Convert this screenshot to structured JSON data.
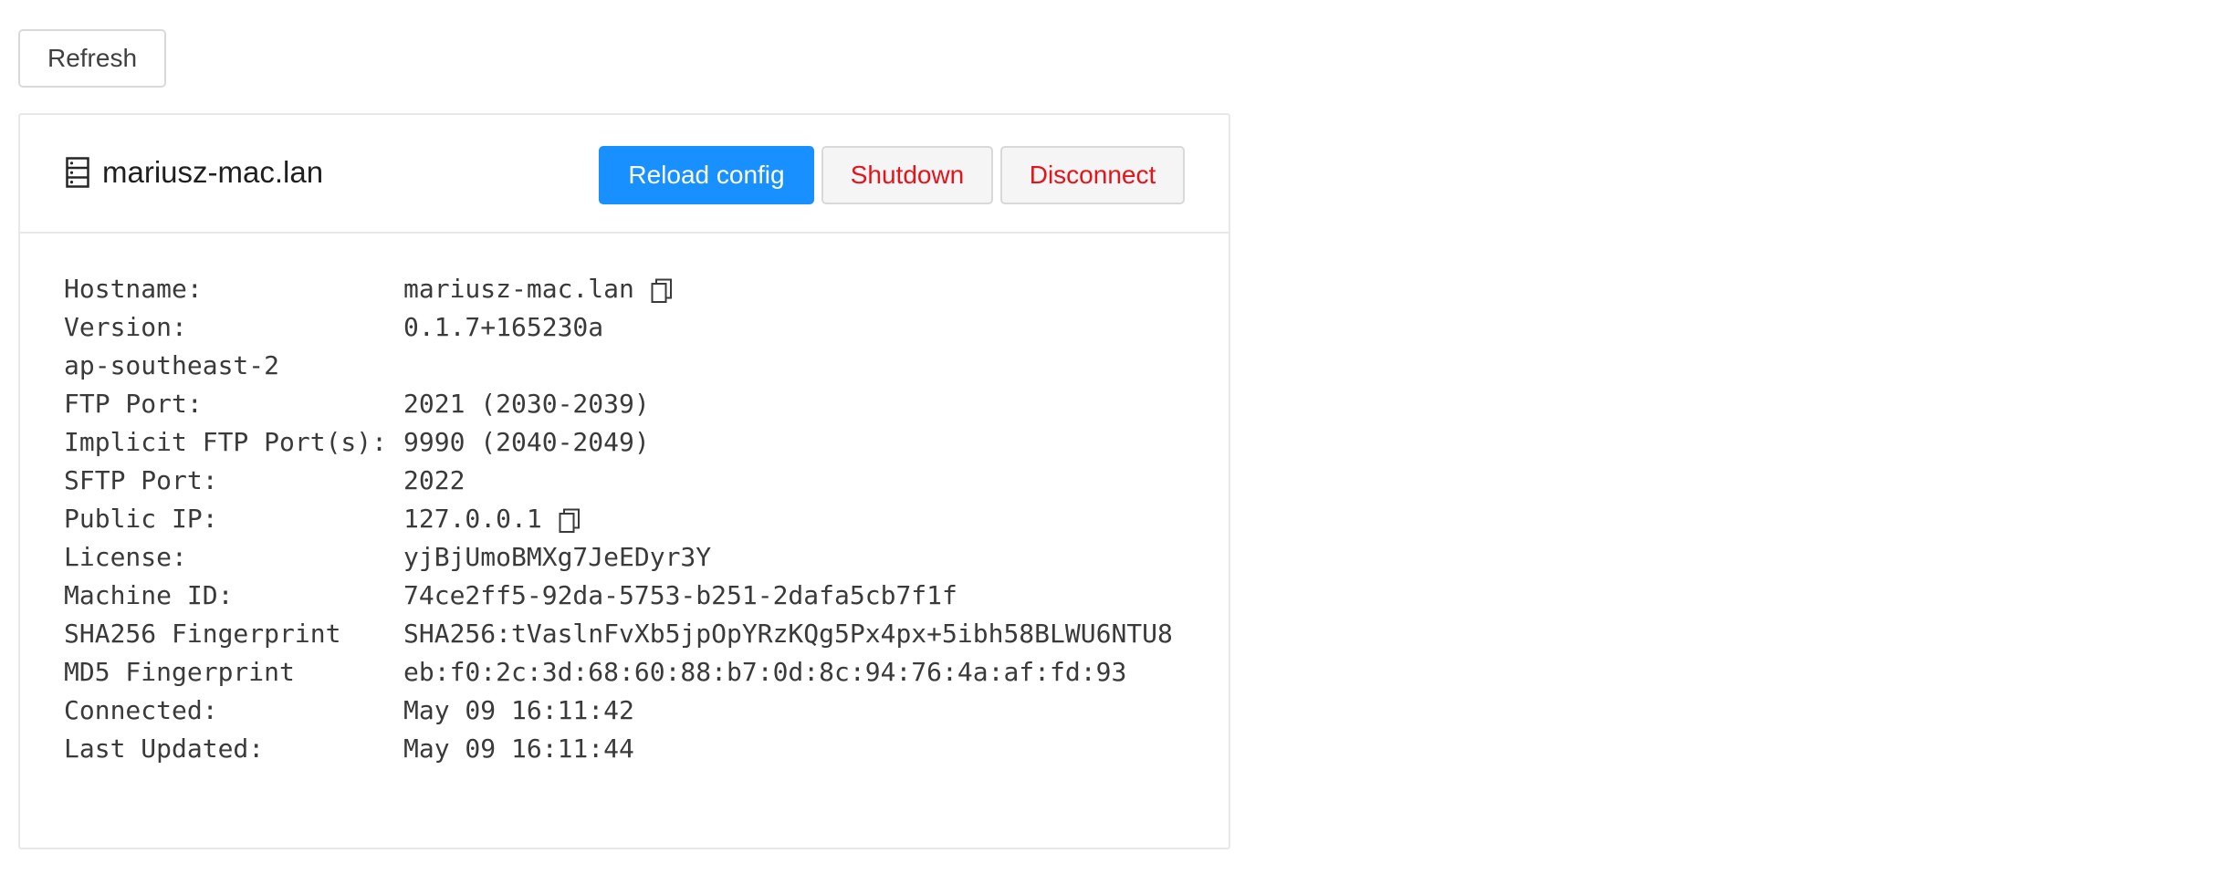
{
  "toolbar": {
    "refresh_label": "Refresh"
  },
  "card": {
    "icon": "server-icon",
    "title": "mariusz-mac.lan",
    "actions": {
      "reload_label": "Reload config",
      "shutdown_label": "Shutdown",
      "disconnect_label": "Disconnect"
    }
  },
  "info": {
    "hostname": {
      "label": "Hostname:",
      "value": "mariusz-mac.lan"
    },
    "version": {
      "label": "Version:",
      "value": "0.1.7+165230a"
    },
    "region": {
      "label": "ap-southeast-2"
    },
    "ftp_port": {
      "label": "FTP Port:",
      "value": "2021 (2030-2039)"
    },
    "implicit_ftp_port": {
      "label": "Implicit FTP Port(s):",
      "value": "9990 (2040-2049)"
    },
    "sftp_port": {
      "label": "SFTP Port:",
      "value": "2022"
    },
    "public_ip": {
      "label": "Public IP:",
      "value": "127.0.0.1"
    },
    "license": {
      "label": "License:",
      "value": "yjBjUmoBMXg7JeEDyr3Y"
    },
    "machine_id": {
      "label": "Machine ID:",
      "value": "74ce2ff5-92da-5753-b251-2dafa5cb7f1f"
    },
    "sha256": {
      "label": "SHA256 Fingerprint",
      "value": "SHA256:tVaslnFvXb5jpOpYRzKQg5Px4px+5ibh58BLWU6NTU8"
    },
    "md5": {
      "label": "MD5 Fingerprint",
      "value": "eb:f0:2c:3d:68:60:88:b7:0d:8c:94:76:4a:af:fd:93"
    },
    "connected": {
      "label": "Connected:",
      "value": "May 09 16:11:42"
    },
    "last_updated": {
      "label": "Last Updated:",
      "value": "May 09 16:11:44"
    }
  },
  "colors": {
    "primary": "#1890ff",
    "danger": "#e5131b",
    "border": "#e8e8e8"
  }
}
